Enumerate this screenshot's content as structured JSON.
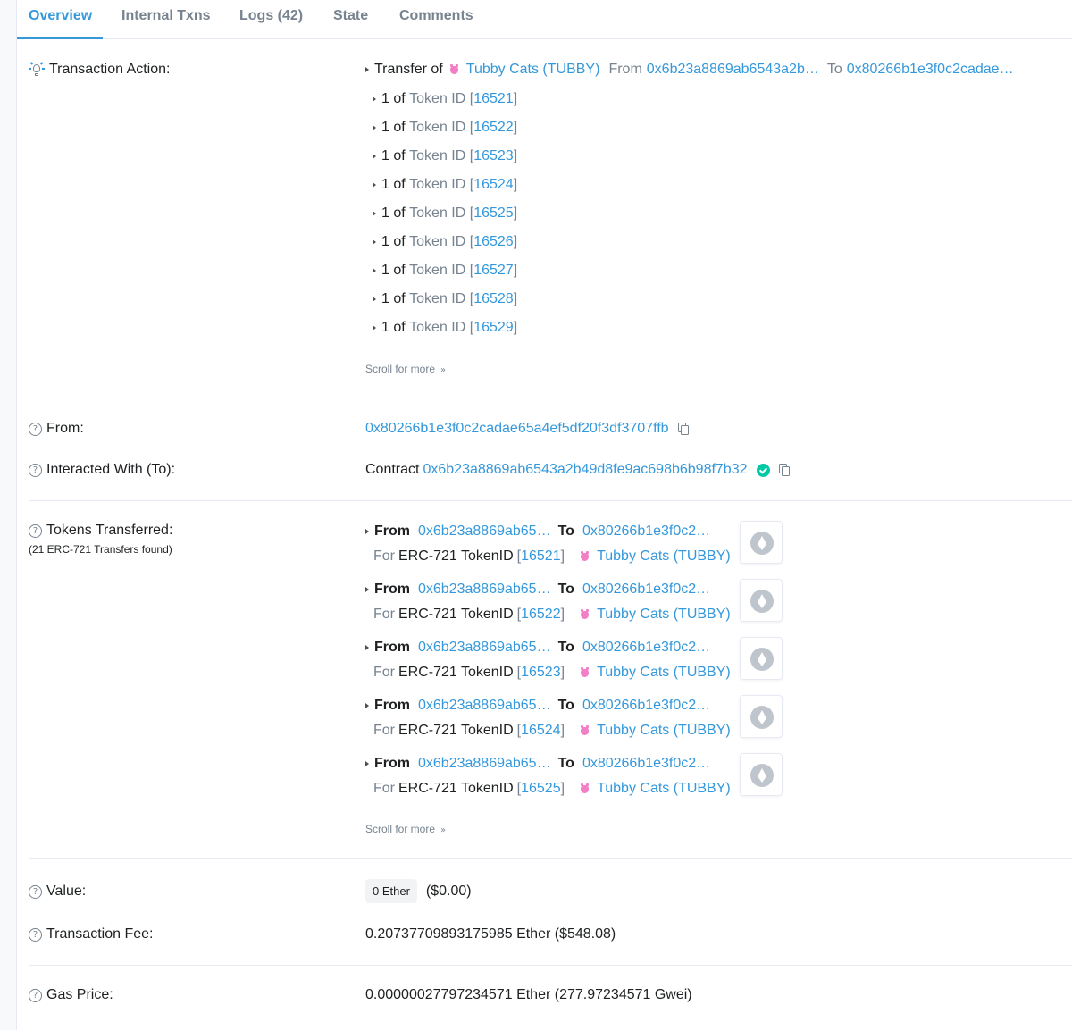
{
  "tabs": [
    {
      "label": "Overview",
      "active": true
    },
    {
      "label": "Internal Txns"
    },
    {
      "label": "Logs (42)"
    },
    {
      "label": "State"
    },
    {
      "label": "Comments"
    }
  ],
  "transaction_action": {
    "label": "Transaction Action:",
    "transfer_of": "Transfer of",
    "token_name": "Tubby Cats (TUBBY)",
    "from_word": "From",
    "from_addr": "0x6b23a8869ab6543a2b…",
    "to_word": "To",
    "to_addr": "0x80266b1e3f0c2cadae…",
    "token_items": [
      {
        "qty": "1",
        "of": "of",
        "token_id_label": "Token ID",
        "id": "16521"
      },
      {
        "qty": "1",
        "of": "of",
        "token_id_label": "Token ID",
        "id": "16522"
      },
      {
        "qty": "1",
        "of": "of",
        "token_id_label": "Token ID",
        "id": "16523"
      },
      {
        "qty": "1",
        "of": "of",
        "token_id_label": "Token ID",
        "id": "16524"
      },
      {
        "qty": "1",
        "of": "of",
        "token_id_label": "Token ID",
        "id": "16525"
      },
      {
        "qty": "1",
        "of": "of",
        "token_id_label": "Token ID",
        "id": "16526"
      },
      {
        "qty": "1",
        "of": "of",
        "token_id_label": "Token ID",
        "id": "16527"
      },
      {
        "qty": "1",
        "of": "of",
        "token_id_label": "Token ID",
        "id": "16528"
      },
      {
        "qty": "1",
        "of": "of",
        "token_id_label": "Token ID",
        "id": "16529"
      }
    ],
    "scroll_more": "Scroll for more"
  },
  "from": {
    "label": "From:",
    "address": "0x80266b1e3f0c2cadae65a4ef5df20f3df3707ffb"
  },
  "interacted": {
    "label": "Interacted With (To):",
    "prefix": "Contract",
    "address": "0x6b23a8869ab6543a2b49d8fe9ac698b6b98f7b32"
  },
  "tokens_transferred": {
    "label": "Tokens Transferred:",
    "sublabel": "(21 ERC-721 Transfers found)",
    "transfers": [
      {
        "from_word": "From",
        "from_addr": "0x6b23a8869ab65…",
        "to_word": "To",
        "to_addr": "0x80266b1e3f0c2…",
        "for_word": "For",
        "type": "ERC-721 TokenID",
        "id": "16521",
        "token": "Tubby Cats (TUBBY)"
      },
      {
        "from_word": "From",
        "from_addr": "0x6b23a8869ab65…",
        "to_word": "To",
        "to_addr": "0x80266b1e3f0c2…",
        "for_word": "For",
        "type": "ERC-721 TokenID",
        "id": "16522",
        "token": "Tubby Cats (TUBBY)"
      },
      {
        "from_word": "From",
        "from_addr": "0x6b23a8869ab65…",
        "to_word": "To",
        "to_addr": "0x80266b1e3f0c2…",
        "for_word": "For",
        "type": "ERC-721 TokenID",
        "id": "16523",
        "token": "Tubby Cats (TUBBY)"
      },
      {
        "from_word": "From",
        "from_addr": "0x6b23a8869ab65…",
        "to_word": "To",
        "to_addr": "0x80266b1e3f0c2…",
        "for_word": "For",
        "type": "ERC-721 TokenID",
        "id": "16524",
        "token": "Tubby Cats (TUBBY)"
      },
      {
        "from_word": "From",
        "from_addr": "0x6b23a8869ab65…",
        "to_word": "To",
        "to_addr": "0x80266b1e3f0c2…",
        "for_word": "For",
        "type": "ERC-721 TokenID",
        "id": "16525",
        "token": "Tubby Cats (TUBBY)"
      }
    ],
    "scroll_more": "Scroll for more"
  },
  "value": {
    "label": "Value:",
    "amount": "0 Ether",
    "usd": "($0.00)"
  },
  "fee": {
    "label": "Transaction Fee:",
    "amount": "0.20737709893175985 Ether ($548.08)"
  },
  "gas_price": {
    "label": "Gas Price:",
    "amount": "0.00000027797234571 Ether (277.97234571 Gwei)"
  },
  "colors": {
    "link": "#3498db",
    "muted": "#77838f",
    "accent_pink": "#f27ec6",
    "verified_green": "#00c9a7"
  },
  "icons": {
    "help": "?",
    "chevron_double_down": "»"
  }
}
